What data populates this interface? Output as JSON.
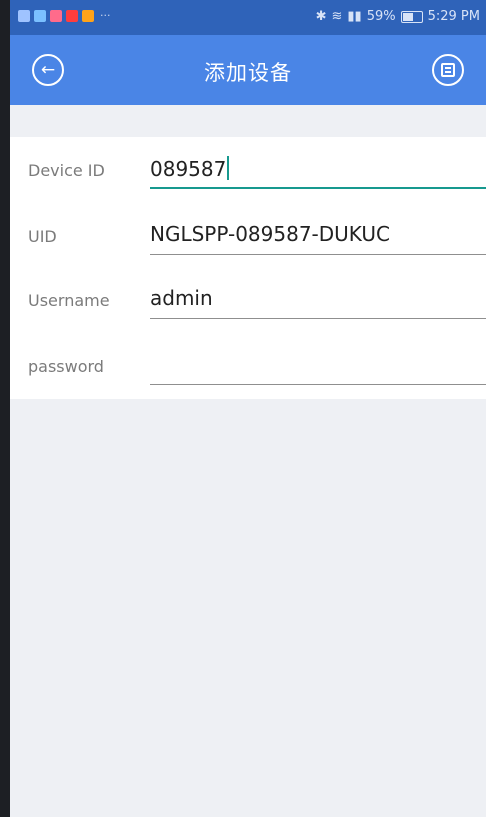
{
  "status_bar": {
    "bluetooth_icon": "bluetooth-icon",
    "wifi_icon": "wifi-icon",
    "signal_icon": "signal-icon",
    "battery_text": "59%",
    "time": "5:29 PM"
  },
  "app_bar": {
    "title": "添加设备",
    "back_icon": "back-arrow-icon",
    "save_icon": "save-icon",
    "accent_color": "#4a85e6"
  },
  "form": {
    "device_id": {
      "label": "Device ID",
      "value": "089587"
    },
    "uid": {
      "label": "UID",
      "value": "NGLSPP-089587-DUKUC"
    },
    "username": {
      "label": "Username",
      "value": "admin"
    },
    "password": {
      "label": "password",
      "value": ""
    },
    "active_color": "#17998f"
  }
}
